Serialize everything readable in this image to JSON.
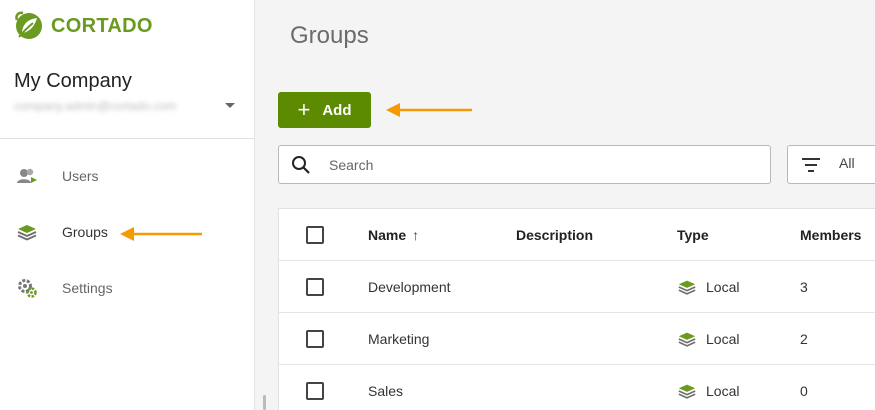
{
  "brand": {
    "name": "CORTADO",
    "color": "#6a9a1f"
  },
  "account": {
    "company": "My Company",
    "email": "company.admin@cortado.com"
  },
  "sidebar": {
    "items": [
      {
        "label": "Users",
        "icon": "users-icon"
      },
      {
        "label": "Groups",
        "icon": "layers-icon",
        "active": true
      },
      {
        "label": "Settings",
        "icon": "settings-gear-icon"
      }
    ]
  },
  "main": {
    "title": "Groups",
    "add_label": "Add",
    "search_placeholder": "Search",
    "filter_value": "All",
    "accent_color": "#5c8a00",
    "annotation_color": "#f59a00"
  },
  "table": {
    "columns": {
      "name": "Name",
      "description": "Description",
      "type": "Type",
      "members": "Members"
    },
    "sort": {
      "column": "Name",
      "direction": "ascending"
    },
    "rows": [
      {
        "name": "Development",
        "description": "",
        "type": "Local",
        "members": "3"
      },
      {
        "name": "Marketing",
        "description": "",
        "type": "Local",
        "members": "2"
      },
      {
        "name": "Sales",
        "description": "",
        "type": "Local",
        "members": "0"
      }
    ]
  }
}
